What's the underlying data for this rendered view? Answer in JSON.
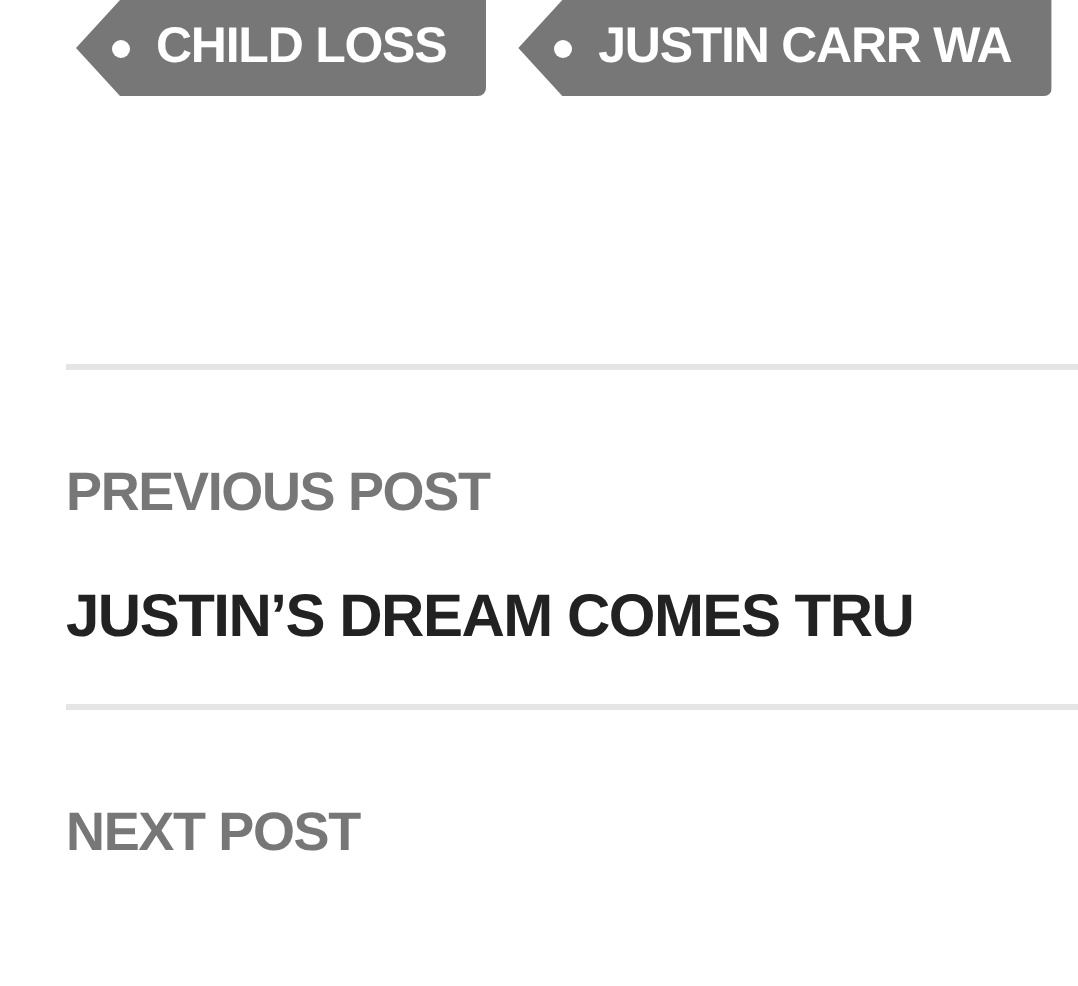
{
  "tags": [
    {
      "label": "CHILD LOSS"
    },
    {
      "label": "JUSTIN CARR WA"
    }
  ],
  "post_navigation": [
    {
      "heading": "PREVIOUS POST",
      "title": "JUSTIN’S DREAM COMES TRU"
    },
    {
      "heading": "NEXT POST"
    }
  ]
}
